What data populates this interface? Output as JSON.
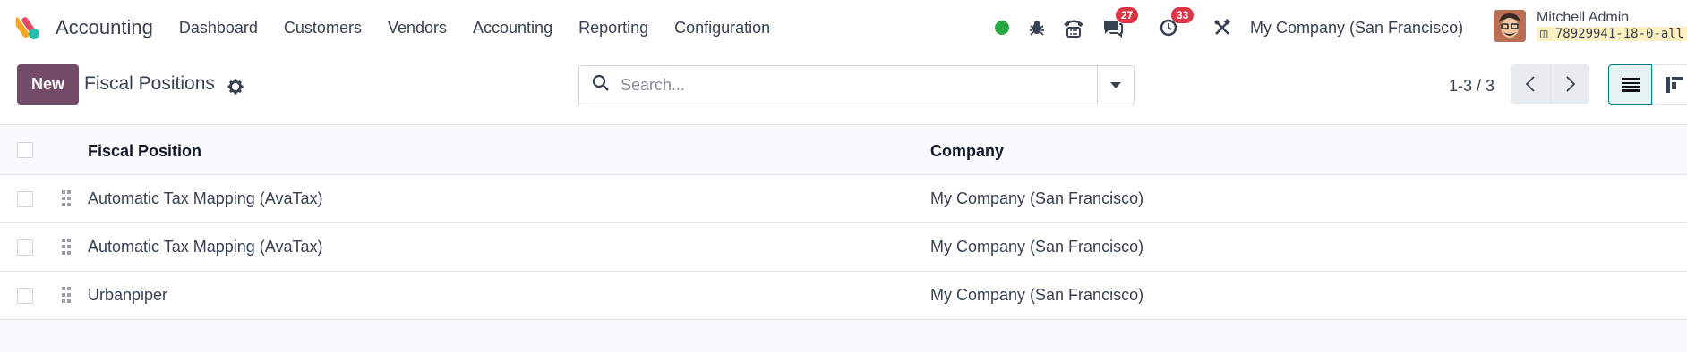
{
  "app": {
    "name": "Accounting",
    "menu": [
      "Dashboard",
      "Customers",
      "Vendors",
      "Accounting",
      "Reporting",
      "Configuration"
    ]
  },
  "systray": {
    "status_color": "#28a745",
    "messages_count": "27",
    "activities_count": "33",
    "company": "My Company (San Francisco)",
    "user_name": "Mitchell Admin",
    "db_name": "78929941-18-0-all"
  },
  "control": {
    "new_label": "New",
    "title": "Fiscal Positions",
    "search_placeholder": "Search...",
    "pager": "1-3 / 3"
  },
  "table": {
    "headers": [
      "Fiscal Position",
      "Company"
    ],
    "rows": [
      [
        "Automatic Tax Mapping (AvaTax)",
        "My Company (San Francisco)"
      ],
      [
        "Automatic Tax Mapping (AvaTax)",
        "My Company (San Francisco)"
      ],
      [
        "Urbanpiper",
        "My Company (San Francisco)"
      ]
    ]
  },
  "colors": {
    "brand": "#714b67",
    "active_view": "#017e84",
    "badge": "#dc3545"
  }
}
